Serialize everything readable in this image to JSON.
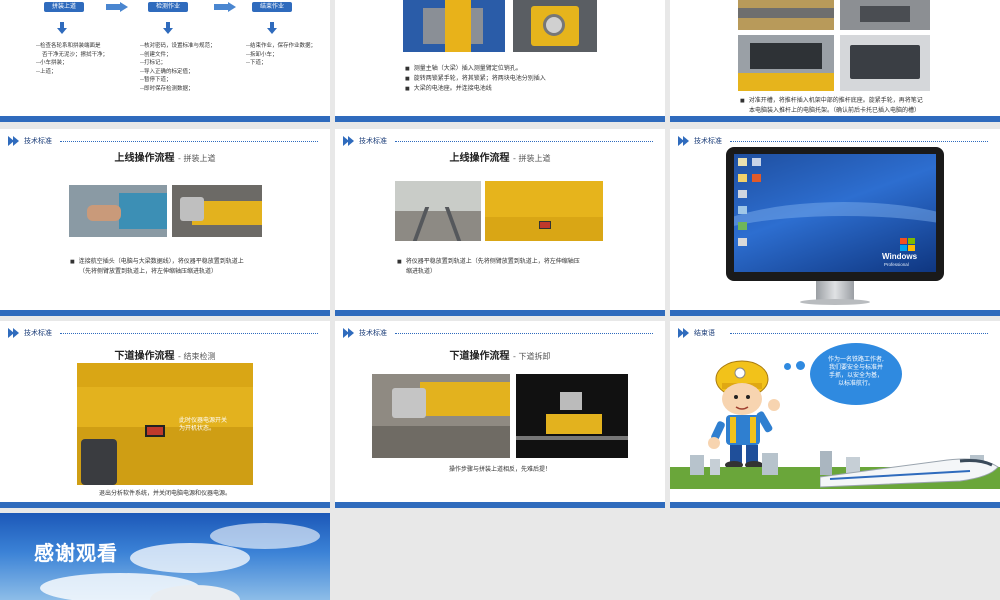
{
  "header_label": "技术标准",
  "slide1": {
    "flow_boxes": [
      "拼装上道",
      "检测作业",
      "结束作业"
    ],
    "col1": [
      "--检查各轮系和拼装端面是",
      "否干净无泥沙；擦拭干净；",
      "--小车拼装；",
      "--上道；"
    ],
    "col2": [
      "--核对密码，设置标准与规范；",
      "--创建文件；",
      "--打标记；",
      "--导入正确的标定值；",
      "--暂停下道；",
      "--即时保存检测数据；"
    ],
    "col3": [
      "--结束作业，保存作业数据；",
      "--拆卸小车；",
      "--下道；"
    ]
  },
  "slide2": {
    "bullets": [
      "测量主轴（大梁）插入测量臂定位销孔。",
      "旋转两锁紧手轮，将其锁紧；将两块电池分别插入",
      "大梁的电池座。并连接电池线"
    ]
  },
  "slide3": {
    "bullets": [
      "对准开槽，将推杆插入机架中部的推杆底座。旋紧手轮，再将笔记",
      "本电脑装入推杆上的电脑托架。（确认前后卡托已插入电脑的槽）"
    ]
  },
  "slide4": {
    "title": "上线操作流程",
    "subtitle": "- 拼装上道",
    "caption": [
      "连接航空插头（电脑与大梁数据线），将仪器平稳放置到轨道上",
      "（先将侧臂放置到轨道上，将左伸缩轴压缩进轨道）"
    ]
  },
  "slide5": {
    "title": "上线操作流程",
    "subtitle": "- 拼装上道",
    "caption": [
      "将仪器平稳放置到轨道上（先将侧臂放置到轨道上，将左伸缩轴压",
      "缩进轨道）"
    ]
  },
  "slide6": {
    "brand": "Windows",
    "edition": "Professional"
  },
  "slide7": {
    "title": "下道操作流程",
    "subtitle": "- 结束检测",
    "overlay": [
      "此时仪器电源开关",
      "为开机状态。"
    ],
    "caption": "退出分析软件系统，并关闭电脑电源和仪器电源。"
  },
  "slide8": {
    "title": "下道操作流程",
    "subtitle": "- 下道拆卸",
    "caption": "操作步骤与拼装上道相反，先难后提！"
  },
  "slide9": {
    "header": "结束语",
    "speech": [
      "作为一名铁路工作者,",
      "我们要安全与标准并",
      "手抓，以安全为基，",
      "以标准航行。"
    ]
  },
  "slide10": {
    "thanks": "感谢观看"
  },
  "colors": {
    "accent": "#2f6bbd",
    "header_text": "#1e3f7a"
  }
}
